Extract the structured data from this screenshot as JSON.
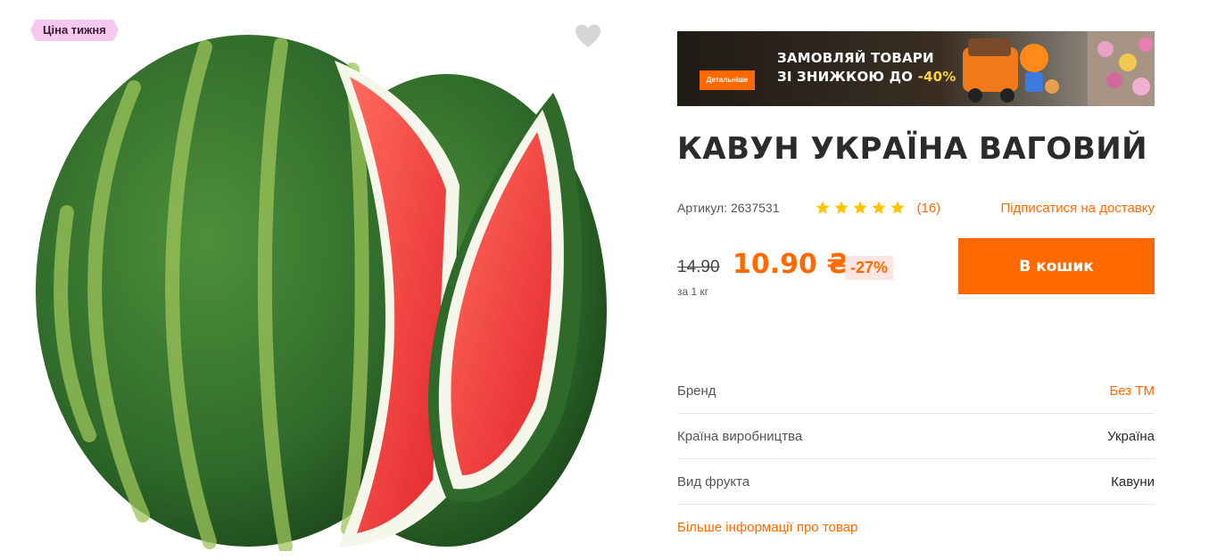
{
  "badge": {
    "label": "Ціна тижня"
  },
  "favorite": {
    "icon": "heart-icon"
  },
  "promo": {
    "button_label": "Детальніше",
    "line1": "ЗАМОВЛЯЙ ТОВАРИ",
    "line2_prefix": "ЗІ ЗНИЖКОЮ ДО ",
    "line2_accent": "-40%"
  },
  "product": {
    "title": "КАВУН УКРАЇНА ВАГОВИЙ",
    "sku": "Артикул: 2637531",
    "rating_stars": 5,
    "reviews": "(16)",
    "subscribe_label": "Підписатися на доставку",
    "old_price": "14.90",
    "new_price": "10.90 ₴",
    "discount": "-27%",
    "unit": "за 1 кг",
    "cart_label": "В кошик"
  },
  "specs": [
    {
      "label": "Бренд",
      "value": "Без ТМ"
    },
    {
      "label": "Країна виробництва",
      "value": "Україна"
    },
    {
      "label": "Вид фрукта",
      "value": "Кавуни"
    }
  ],
  "more_info_label": "Більше інформації про товар",
  "colors": {
    "accent": "#ff6a00",
    "badge": "#f7c8ef",
    "star": "#ffc400"
  }
}
